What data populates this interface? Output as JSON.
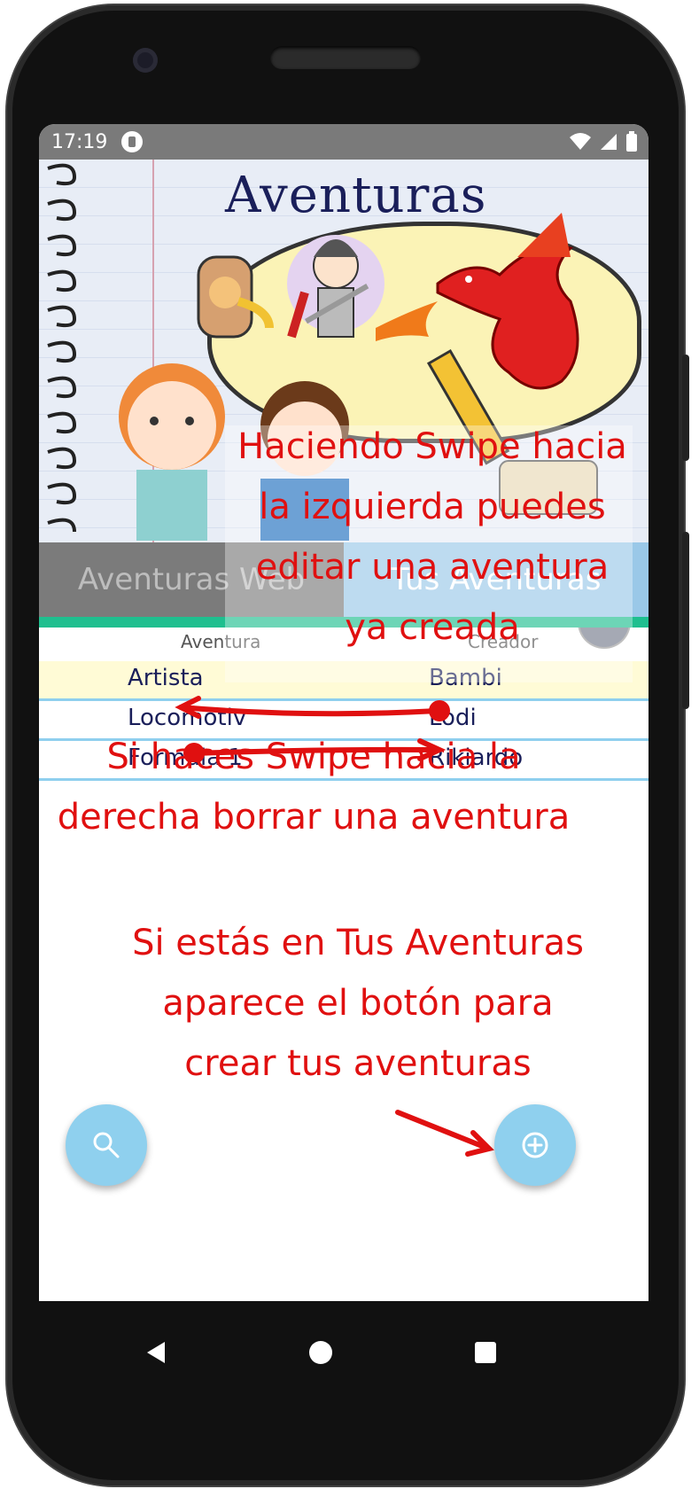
{
  "status_bar": {
    "time": "17:19"
  },
  "header": {
    "title": "Aventuras"
  },
  "tabs": [
    {
      "label": "Aventuras Web"
    },
    {
      "label": "Tus Aventuras"
    }
  ],
  "table": {
    "columns": [
      "Aventura",
      "Creador"
    ],
    "rows": [
      {
        "aventura": "Artista",
        "creador": "Bambi"
      },
      {
        "aventura": "Locomotiv",
        "creador": "Lodi"
      },
      {
        "aventura": "Formula 1",
        "creador": "Rikiardo"
      }
    ]
  },
  "annotations": {
    "swipe_left_lines": [
      "Haciendo Swipe hacia",
      "la izquierda puedes",
      "editar una aventura",
      "ya creada"
    ],
    "swipe_right_lines": [
      "Si haces Swipe hacia la",
      "derecha borrar una aventura"
    ],
    "create_lines": [
      "Si estás en Tus Aventuras",
      "aparece el botón para",
      "crear tus aventuras"
    ]
  },
  "colors": {
    "accent_green": "#1fbf8f",
    "tab_selected": "#9ac8e8",
    "fab": "#8fd0ee",
    "annotation_red": "#e01010"
  },
  "icons": [
    "search-icon",
    "add-circle-icon",
    "help-icon",
    "nav-back-icon",
    "nav-home-icon",
    "nav-recents-icon"
  ]
}
